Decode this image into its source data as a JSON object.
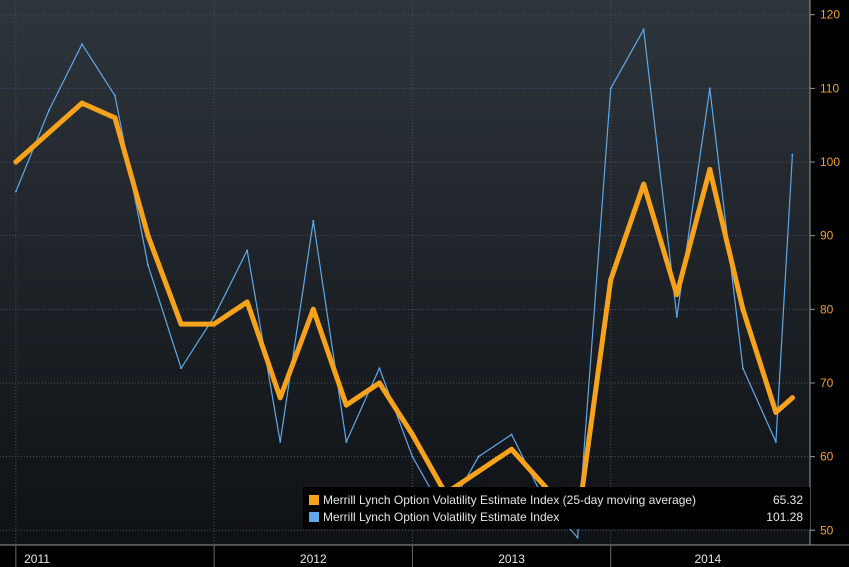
{
  "chart_data": {
    "type": "line",
    "title": "",
    "xlabel": "",
    "ylabel": "",
    "ylim": [
      48,
      122
    ],
    "y_ticks": [
      50,
      60,
      70,
      80,
      90,
      100,
      110,
      120
    ],
    "x_tick_labels": [
      "2011",
      "2012",
      "2013",
      "2014"
    ],
    "grid": true,
    "legend_position": "bottom-right",
    "x": [
      "2011-01",
      "2011-03",
      "2011-05",
      "2011-07",
      "2011-09",
      "2011-11",
      "2012-01",
      "2012-03",
      "2012-05",
      "2012-07",
      "2012-09",
      "2012-11",
      "2013-01",
      "2013-03",
      "2013-05",
      "2013-07",
      "2013-09",
      "2013-11",
      "2014-01",
      "2014-03",
      "2014-05",
      "2014-07",
      "2014-09",
      "2014-11",
      "2014-12"
    ],
    "series": [
      {
        "name": "Merrill Lynch Option Volatility Estimate Index (25-day moving average)",
        "last_value": "65.32",
        "color": "#f7a21b",
        "values": [
          100,
          104,
          108,
          106,
          90,
          78,
          78,
          81,
          68,
          80,
          67,
          70,
          63,
          55,
          58,
          61,
          56,
          51,
          84,
          97,
          82,
          99,
          80,
          66,
          68
        ]
      },
      {
        "name": "Merrill Lynch Option Volatility Estimate Index",
        "last_value": "101.28",
        "color": "#5fa8e8",
        "values": [
          96,
          107,
          116,
          109,
          86,
          72,
          79,
          88,
          62,
          92,
          62,
          72,
          60,
          52,
          60,
          63,
          54,
          49,
          110,
          118,
          79,
          110,
          72,
          62,
          101
        ]
      }
    ]
  }
}
